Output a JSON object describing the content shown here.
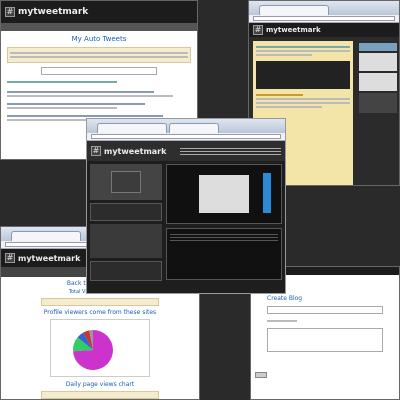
{
  "brand": "mytweetmark",
  "panels": {
    "top_left": {
      "heading": "My Auto Tweets"
    },
    "bottom_left": {
      "heading": "Back to mytweetmark",
      "total_views": "Total Views: 13413 times",
      "chart_title": "Profile viewers come from these sites",
      "section_title": "Daily page views chart"
    },
    "bottom_right": {
      "heading": "Create Blog"
    }
  },
  "colors": {
    "header": "#1c1c1c",
    "page_dark": "#2a2a2a",
    "accent_blue": "#1a5fb4",
    "pie": [
      "#cc33cc",
      "#33cc66",
      "#3366cc",
      "#cc3333",
      "#999999"
    ]
  },
  "pie_values": [
    0.74,
    0.12,
    0.06,
    0.05,
    0.03
  ]
}
